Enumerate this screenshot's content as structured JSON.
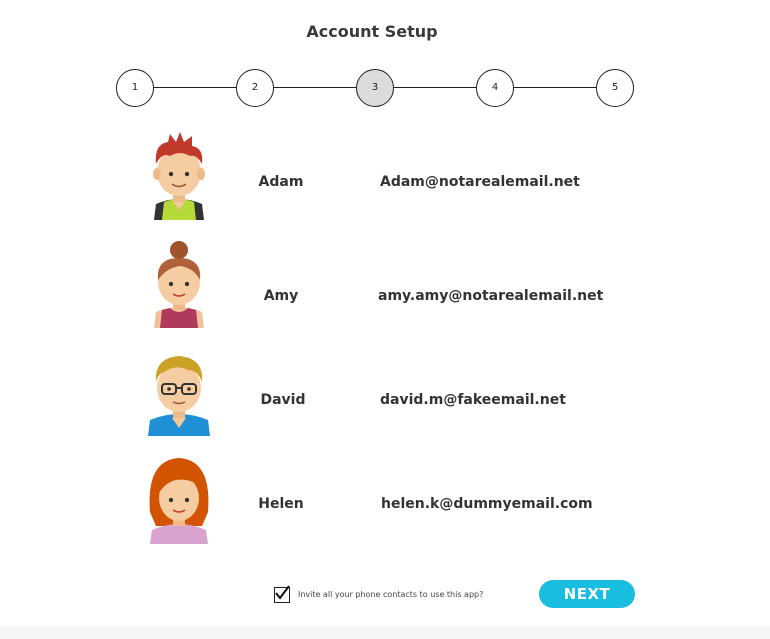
{
  "page": {
    "title": "Account Setup"
  },
  "stepper": {
    "steps": [
      "1",
      "2",
      "3",
      "4",
      "5"
    ],
    "active_step": "3"
  },
  "contacts": [
    {
      "name": "Adam",
      "email": "Adam@notarealemail.net",
      "avatar": "boy-redhair-avatar-icon"
    },
    {
      "name": "Amy",
      "email": "amy.amy@notarealemail.net",
      "avatar": "woman-bun-avatar-icon"
    },
    {
      "name": "David",
      "email": "david.m@fakeemail.net",
      "avatar": "man-glasses-avatar-icon"
    },
    {
      "name": "Helen",
      "email": "helen.k@dummyemail.com",
      "avatar": "woman-redhair-avatar-icon"
    }
  ],
  "invite": {
    "checked": true,
    "label": "Invite all your phone contacts to use this app?"
  },
  "actions": {
    "next_label": "NEXT"
  },
  "colors": {
    "accent": "#19bde0",
    "active_step": "#dcdcdc",
    "text": "#333333"
  }
}
